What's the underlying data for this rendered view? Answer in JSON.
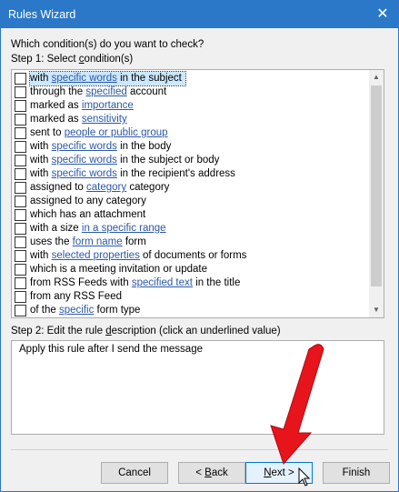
{
  "window": {
    "title": "Rules Wizard",
    "close_glyph": "✕"
  },
  "prompt": "Which condition(s) do you want to check?",
  "step1_label": {
    "prefix": "Step 1: Select ",
    "underlined": "c",
    "suffix": "ondition(s)"
  },
  "conditions": [
    {
      "before": "with ",
      "link": "specific words",
      "after": " in the subject",
      "selected": true
    },
    {
      "before": "through the ",
      "link": "specified",
      "after": " account"
    },
    {
      "before": "marked as ",
      "link": "importance",
      "after": ""
    },
    {
      "before": "marked as ",
      "link": "sensitivity",
      "after": ""
    },
    {
      "before": "sent to ",
      "link": "people or public group",
      "after": ""
    },
    {
      "before": "with ",
      "link": "specific words",
      "after": " in the body"
    },
    {
      "before": "with ",
      "link": "specific words",
      "after": " in the subject or body"
    },
    {
      "before": "with ",
      "link": "specific words",
      "after": " in the recipient's address"
    },
    {
      "before": "assigned to ",
      "link": "category",
      "after": " category"
    },
    {
      "before": "assigned to any category",
      "link": "",
      "after": ""
    },
    {
      "before": "which has an attachment",
      "link": "",
      "after": ""
    },
    {
      "before": "with a size ",
      "link": "in a specific range",
      "after": ""
    },
    {
      "before": "uses the ",
      "link": "form name",
      "after": " form"
    },
    {
      "before": "with ",
      "link": "selected properties",
      "after": " of documents or forms"
    },
    {
      "before": "which is a meeting invitation or update",
      "link": "",
      "after": ""
    },
    {
      "before": "from RSS Feeds with ",
      "link": "specified text",
      "after": " in the title"
    },
    {
      "before": "from any RSS Feed",
      "link": "",
      "after": ""
    },
    {
      "before": "of the ",
      "link": "specific",
      "after": " form type"
    }
  ],
  "step2_label": {
    "prefix": "Step 2: Edit the rule ",
    "underlined": "d",
    "suffix": "escription (click an underlined value)"
  },
  "description": "Apply this rule after I send the message",
  "buttons": {
    "cancel": "Cancel",
    "back": {
      "prefix": "< ",
      "underlined": "B",
      "suffix": "ack"
    },
    "next": {
      "underlined": "N",
      "suffix": "ext >"
    },
    "finish": "Finish"
  },
  "colors": {
    "titlebar": "#2b78c9",
    "link": "#2b58a8",
    "annotation_arrow": "#e8141b"
  }
}
